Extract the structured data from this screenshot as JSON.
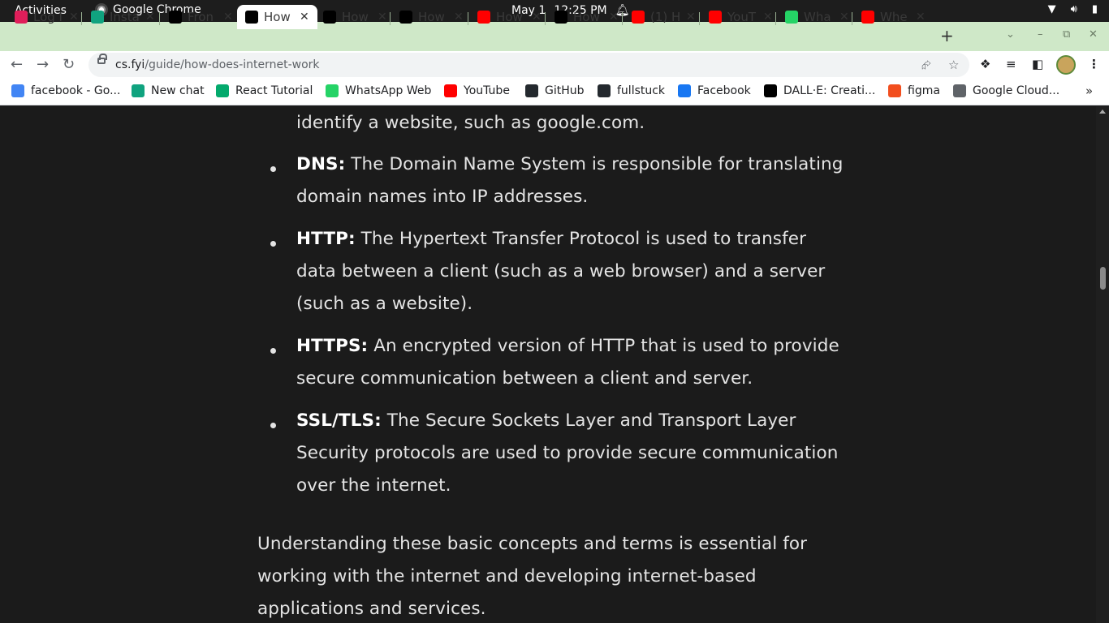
{
  "system_bar": {
    "activities": "Activities",
    "app_name": "Google Chrome",
    "date": "May 1",
    "time": "12:25 PM"
  },
  "tabs": [
    {
      "title": "Log I",
      "icon": "slack-icon",
      "color": "#e01e5a"
    },
    {
      "title": "Insta",
      "icon": "openai-icon",
      "color": "#10a37f"
    },
    {
      "title": "Fron",
      "icon": "roadmap-icon",
      "color": "#000000"
    },
    {
      "title": "How",
      "icon": "cs-icon",
      "color": "#000000",
      "active": true
    },
    {
      "title": "How",
      "icon": "cs-icon",
      "color": "#000000"
    },
    {
      "title": "How",
      "icon": "medium-icon",
      "color": "#000000"
    },
    {
      "title": "How",
      "icon": "youtube-icon",
      "color": "#ff0000"
    },
    {
      "title": "How",
      "icon": "roadmap-icon",
      "color": "#000000"
    },
    {
      "title": "(1) H",
      "icon": "youtube-icon",
      "color": "#ff0000"
    },
    {
      "title": "YouT",
      "icon": "youtube-icon",
      "color": "#ff0000"
    },
    {
      "title": "Wha",
      "icon": "whatsapp-icon",
      "color": "#25d366"
    },
    {
      "title": "Whe",
      "icon": "youtube-icon",
      "color": "#ff0000"
    }
  ],
  "toolbar": {
    "url_host": "cs.fyi",
    "url_path": "/guide/how-does-internet-work"
  },
  "bookmarks": [
    {
      "label": "facebook - Go...",
      "icon": "google-icon",
      "color": "#4285f4"
    },
    {
      "label": "New chat",
      "icon": "openai-icon",
      "color": "#10a37f"
    },
    {
      "label": "React Tutorial",
      "icon": "w3schools-icon",
      "color": "#04aa6d"
    },
    {
      "label": "WhatsApp Web",
      "icon": "whatsapp-icon",
      "color": "#25d366"
    },
    {
      "label": "YouTube",
      "icon": "youtube-icon",
      "color": "#ff0000"
    },
    {
      "label": "GitHub",
      "icon": "github-icon",
      "color": "#24292e"
    },
    {
      "label": "fullstuck",
      "icon": "github-icon",
      "color": "#24292e"
    },
    {
      "label": "Facebook",
      "icon": "facebook-icon",
      "color": "#1877f2"
    },
    {
      "label": "DALL·E: Creati...",
      "icon": "openai-icon",
      "color": "#000000"
    },
    {
      "label": "figma",
      "icon": "figma-icon",
      "color": "#f24e1e"
    },
    {
      "label": "Google Cloud...",
      "icon": "gear-icon",
      "color": "#5f6368"
    }
  ],
  "article": {
    "top_fragment": "identify a website, such as google.com.",
    "items": [
      {
        "term": "DNS:",
        "lines": [
          " The Domain Name System is responsible for translating",
          "domain names into IP addresses."
        ]
      },
      {
        "term": "HTTP:",
        "lines": [
          " The Hypertext Transfer Protocol is used to transfer",
          "data between a client (such as a web browser) and a server",
          "(such as a website)."
        ]
      },
      {
        "term": "HTTPS:",
        "lines": [
          " An encrypted version of HTTP that is used to provide",
          "secure communication between a client and server."
        ]
      },
      {
        "term": "SSL/TLS:",
        "lines": [
          " The Secure Sockets Layer and Transport Layer",
          "Security protocols are used to provide secure communication",
          "over the internet."
        ]
      }
    ],
    "conclusion": [
      "Understanding these basic concepts and terms is essential for",
      "working with the internet and developing internet-based",
      "applications and services."
    ]
  }
}
